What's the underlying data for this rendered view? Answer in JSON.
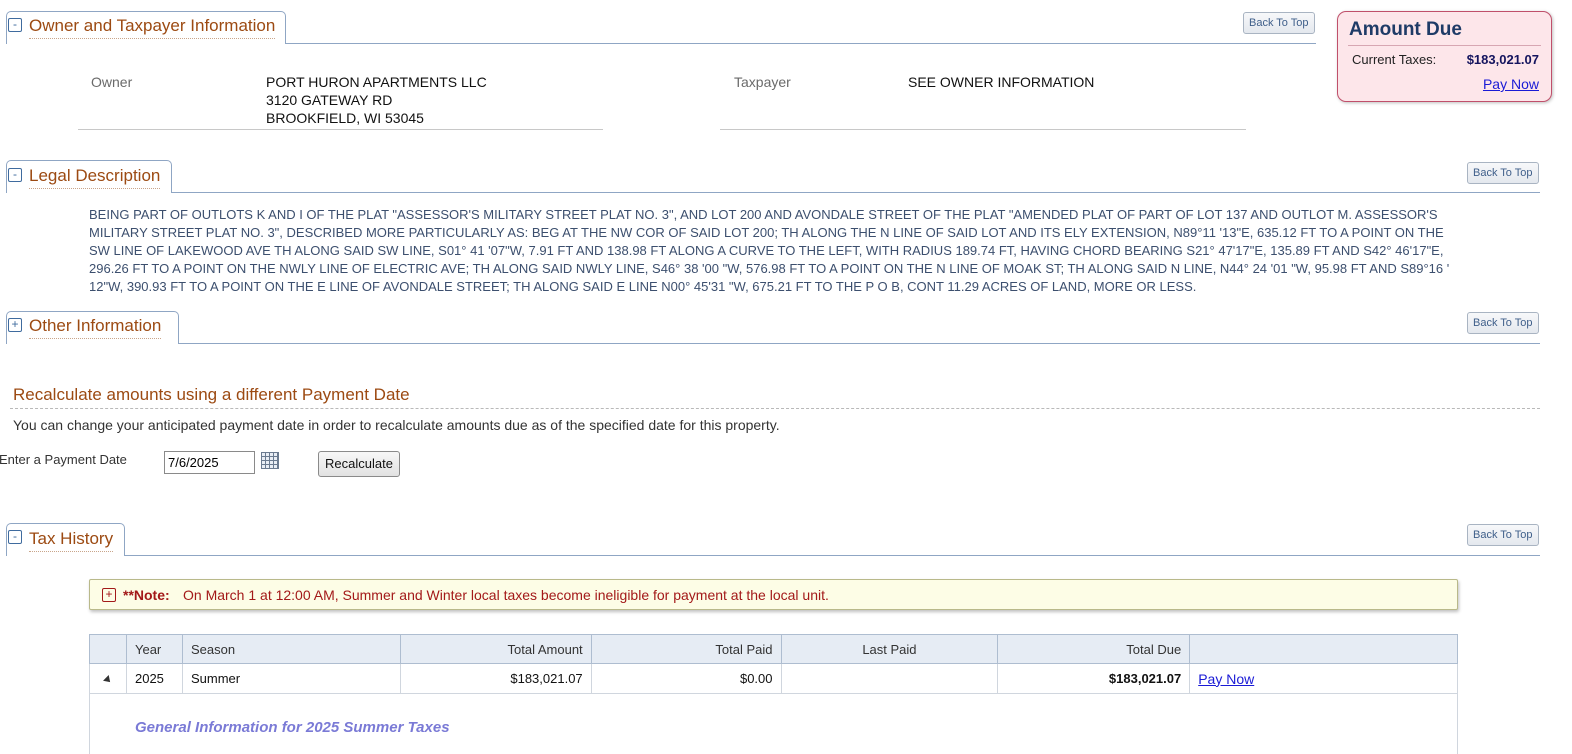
{
  "owner_section": {
    "title": "Owner and Taxpayer Information",
    "toggle": "-",
    "back_to_top": "Back To Top",
    "owner_label": "Owner",
    "owner_lines": [
      "PORT HURON APARTMENTS LLC",
      "3120 GATEWAY RD",
      "BROOKFIELD, WI 53045"
    ],
    "taxpayer_label": "Taxpayer",
    "taxpayer_value": "SEE OWNER INFORMATION"
  },
  "amount_due": {
    "title": "Amount Due",
    "current_taxes_label": "Current Taxes:",
    "current_taxes_value": "$183,021.07",
    "pay_now": "Pay Now",
    "colors": {
      "border": "#c0506b",
      "background": "#fde6ea"
    }
  },
  "legal_section": {
    "title": "Legal Description",
    "toggle": "-",
    "back_to_top": "Back To Top",
    "text": "BEING PART OF OUTLOTS K AND I OF THE PLAT \"ASSESSOR'S MILITARY STREET PLAT NO. 3\", AND LOT 200 AND AVONDALE STREET OF THE PLAT \"AMENDED PLAT OF PART OF LOT 137 AND OUTLOT M. ASSESSOR'S MILITARY STREET PLAT NO. 3\", DESCRIBED MORE PARTICULARLY AS: BEG AT THE NW COR OF SAID LOT 200; TH ALONG THE N LINE OF SAID LOT AND ITS ELY EXTENSION, N89°11 '13\"E, 635.12 FT TO A POINT ON THE SW LINE OF LAKEWOOD AVE TH ALONG SAID SW LINE, S01° 41 '07\"W, 7.91 FT AND 138.98 FT ALONG A CURVE TO THE LEFT, WITH RADIUS 189.74 FT, HAVING CHORD BEARING S21° 47'17\"E, 135.89 FT AND S42° 46'17\"E, 296.26 FT TO A POINT ON THE NWLY LINE OF ELECTRIC AVE; TH ALONG SAID NWLY LINE, S46° 38 '00 \"W, 576.98 FT TO A POINT ON THE N LINE OF MOAK ST; TH ALONG SAID N LINE, N44° 24 '01 \"W, 95.98 FT AND S89°16 ' 12\"W, 390.93 FT TO A POINT ON THE E LINE OF AVONDALE STREET; TH ALONG SAID E LINE N00° 45'31 \"W, 675.21 FT TO THE P O B, CONT 11.29 ACRES OF LAND, MORE OR LESS."
  },
  "other_section": {
    "title": "Other Information",
    "toggle": "+",
    "back_to_top": "Back To Top"
  },
  "recalculate": {
    "title": "Recalculate amounts using a different Payment Date",
    "description": "You can change your anticipated payment date in order to recalculate amounts due as of the specified date for this property.",
    "date_label": "Enter a Payment Date",
    "date_value": "7/6/2025",
    "button": "Recalculate"
  },
  "tax_history": {
    "title": "Tax History",
    "toggle": "-",
    "back_to_top": "Back To Top",
    "note_toggle": "+",
    "note_strong": "**Note:",
    "note_text": "On March 1 at 12:00 AM, Summer and Winter local taxes become ineligible for payment at the local unit.",
    "columns": [
      "",
      "Year",
      "Season",
      "Total Amount",
      "Total Paid",
      "Last Paid",
      "Total Due",
      ""
    ],
    "rows": [
      {
        "year": "2025",
        "season": "Summer",
        "total_amount": "$183,021.07",
        "total_paid": "$0.00",
        "last_paid": "",
        "total_due": "$183,021.07",
        "action": "Pay Now"
      }
    ],
    "general_info_title": "General Information for 2025 Summer Taxes"
  }
}
